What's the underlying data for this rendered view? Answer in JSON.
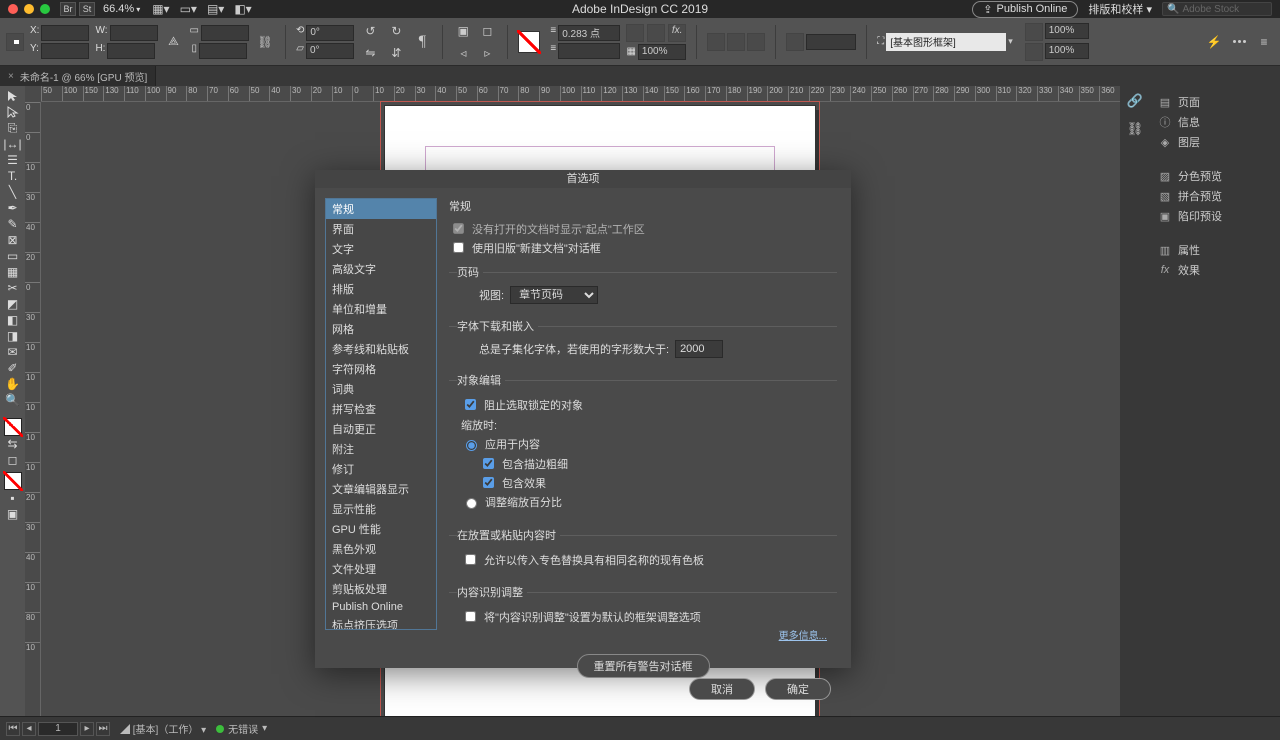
{
  "app": {
    "title": "Adobe InDesign CC 2019",
    "publish": "Publish Online",
    "layout_panel": "排版和校样",
    "stock_search": "Adobe Stock"
  },
  "menubar": {
    "zoom": "66.4%",
    "br": "Br",
    "st": "St"
  },
  "tab": {
    "label": "未命名-1 @ 66% [GPU 预览]"
  },
  "control": {
    "x": "X:",
    "y": "Y:",
    "w": "W:",
    "h": "H:",
    "angle": "0°",
    "shear": "0°",
    "stroke_pt": "0.283 点",
    "opacity": "100%",
    "frame_dropdown": "[基本图形框架]",
    "pct": "100%"
  },
  "ruler_h": [
    "50",
    "100",
    "150",
    "130",
    "110",
    "100",
    "90",
    "80",
    "70",
    "60",
    "50",
    "40",
    "30",
    "20",
    "10",
    "0",
    "10",
    "20",
    "30",
    "40",
    "50",
    "60",
    "70",
    "80",
    "90",
    "100",
    "110",
    "120",
    "130",
    "140",
    "150",
    "160",
    "170",
    "180",
    "190",
    "200",
    "210",
    "220",
    "230",
    "240",
    "250",
    "260",
    "270",
    "280",
    "290",
    "300",
    "310",
    "320",
    "330",
    "340",
    "350",
    "360"
  ],
  "ruler_v": [
    "0",
    "0",
    "10",
    "30",
    "40",
    "20",
    "0",
    "30",
    "10",
    "10",
    "10",
    "10",
    "10",
    "20",
    "30",
    "40",
    "10",
    "80",
    "10"
  ],
  "right_panel": {
    "items_a": [
      "页面",
      "信息",
      "图层"
    ],
    "items_b": [
      "分色预览",
      "拼合预览",
      "陷印预设"
    ],
    "items_c": [
      "属性",
      "效果"
    ]
  },
  "status": {
    "page": "1",
    "master": "[基本]（工作）",
    "errors": "无错误"
  },
  "dialog": {
    "title": "首选项",
    "categories": [
      "常规",
      "界面",
      "文字",
      "高级文字",
      "排版",
      "单位和增量",
      "网格",
      "参考线和粘贴板",
      "字符网格",
      "词典",
      "拼写检查",
      "自动更正",
      "附注",
      "修订",
      "文章编辑器显示",
      "显示性能",
      "GPU 性能",
      "黑色外观",
      "文件处理",
      "剪贴板处理",
      "Publish Online",
      "标点挤压选项"
    ],
    "heading": "常规",
    "opt_show_start": "没有打开的文档时显示\"起点\"工作区",
    "opt_legacy_new": "使用旧版\"新建文档\"对话框",
    "grp_page": "页码",
    "page_view_lbl": "视图:",
    "page_view_val": "章节页码",
    "grp_font": "字体下载和嵌入",
    "font_sub_lbl": "总是子集化字体，若使用的字形数大于:",
    "font_sub_val": "2000",
    "grp_object": "对象编辑",
    "obj_prevent_locked": "阻止选取锁定的对象",
    "scale_heading": "缩放时:",
    "scale_apply_content": "应用于内容",
    "scale_include_stroke": "包含描边粗细",
    "scale_include_effects": "包含效果",
    "scale_adjust_percent": "调整缩放百分比",
    "grp_paste": "在放置或粘贴内容时",
    "paste_allow": "允许以传入专色替换具有相同名称的现有色板",
    "grp_contentaware": "内容识别调整",
    "contentaware_opt": "将\"内容识别调整\"设置为默认的框架调整选项",
    "more_info": "更多信息...",
    "reset": "重置所有警告对话框",
    "cancel": "取消",
    "ok": "确定"
  }
}
